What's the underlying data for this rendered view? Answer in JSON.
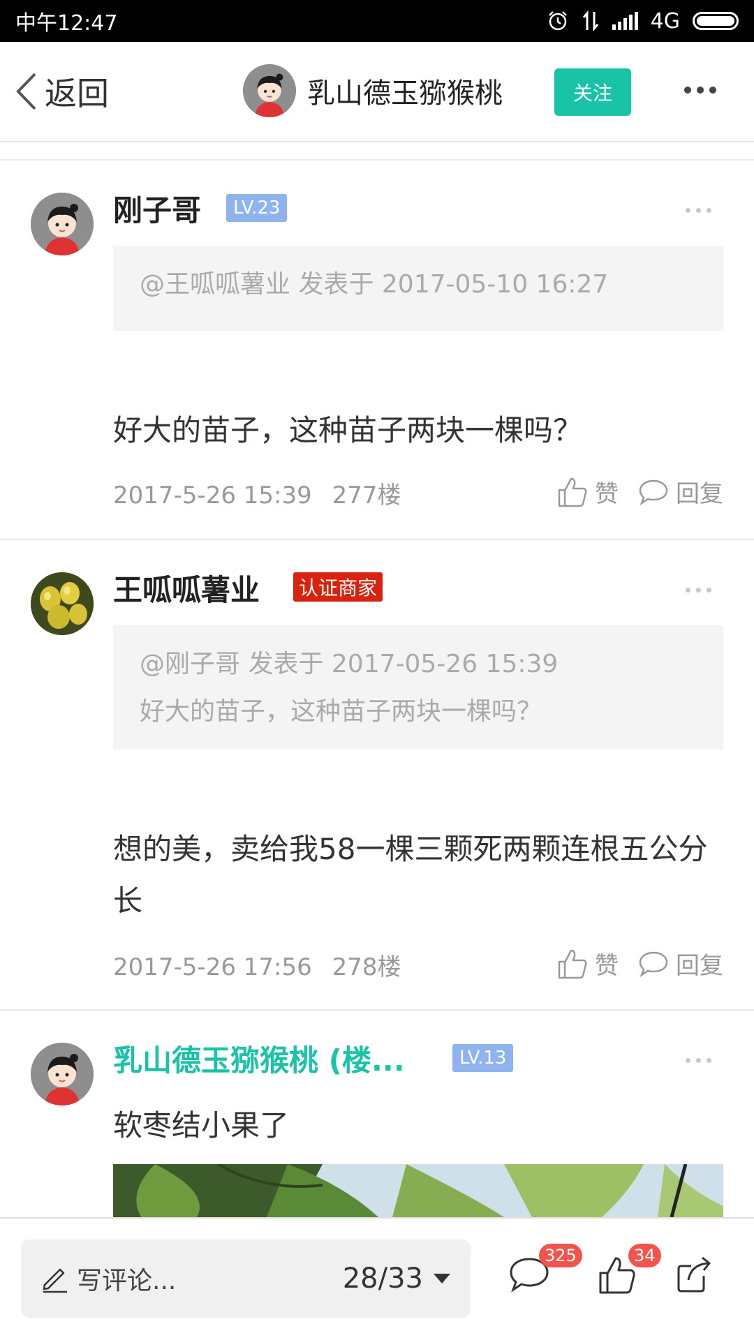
{
  "status_bar": {
    "time": "中午12:47",
    "network": "4G"
  },
  "nav": {
    "back_label": "返回",
    "title": "乳山德玉猕猴桃",
    "follow_label": "关注"
  },
  "comments": [
    {
      "username": "刚子哥",
      "level": "LV.23",
      "quote_header": "@王呱呱薯业 发表于 2017-05-10 16:27",
      "text": "好大的苗子，这种苗子两块一棵吗？",
      "time": "2017-5-26 15:39",
      "floor": "277楼",
      "like_label": "赞",
      "reply_label": "回复"
    },
    {
      "username": "王呱呱薯业",
      "badge": "认证商家",
      "quote_header": "@刚子哥 发表于 2017-05-26 15:39",
      "quote_text": "好大的苗子，这种苗子两块一棵吗？",
      "text": "想的美，卖给我58一棵三颗死两颗连根五公分长",
      "time": "2017-5-26 17:56",
      "floor": "278楼",
      "like_label": "赞",
      "reply_label": "回复"
    },
    {
      "username": "乳山德玉猕猴桃 (楼...",
      "level": "LV.13",
      "text": "软枣结小果了"
    }
  ],
  "bottom_bar": {
    "placeholder": "写评论...",
    "pager": "28/33",
    "comments_count": "325",
    "likes_count": "34"
  },
  "colors": {
    "accent": "#19c3a8",
    "level_badge": "#8fb3ef",
    "merchant_badge": "#d9230f",
    "count_badge": "#f2544c"
  }
}
